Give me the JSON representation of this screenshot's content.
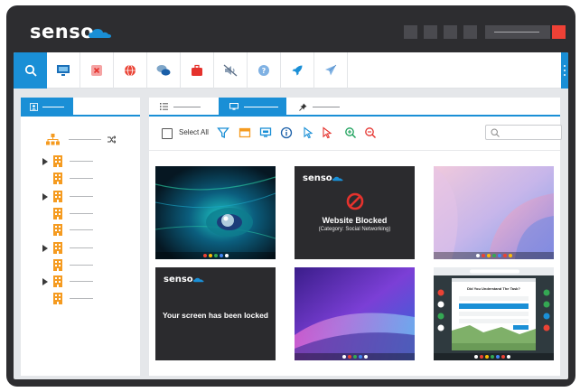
{
  "app": {
    "brand": "senso.",
    "colors": {
      "accent": "#1a8fd6",
      "frame": "#2d2d30",
      "close": "#ef4136",
      "node": "#f59b20",
      "block": "#e5322d"
    }
  },
  "toolbar": {
    "icons": [
      "search-icon",
      "monitor-icon",
      "close-app-icon",
      "globe-icon",
      "chat-icon",
      "briefcase-icon",
      "mute-icon",
      "help-icon",
      "rocket-icon",
      "send-icon"
    ]
  },
  "actions": {
    "select_all": "Select All"
  },
  "screens": {
    "blocked_brand": "senso.",
    "blocked_title": "Website Blocked",
    "blocked_subtitle": "(Category: Social Networking)",
    "locked_brand": "senso.",
    "locked_title": "Your screen has been locked",
    "quiz_title": "Did You Understand The Task?"
  }
}
